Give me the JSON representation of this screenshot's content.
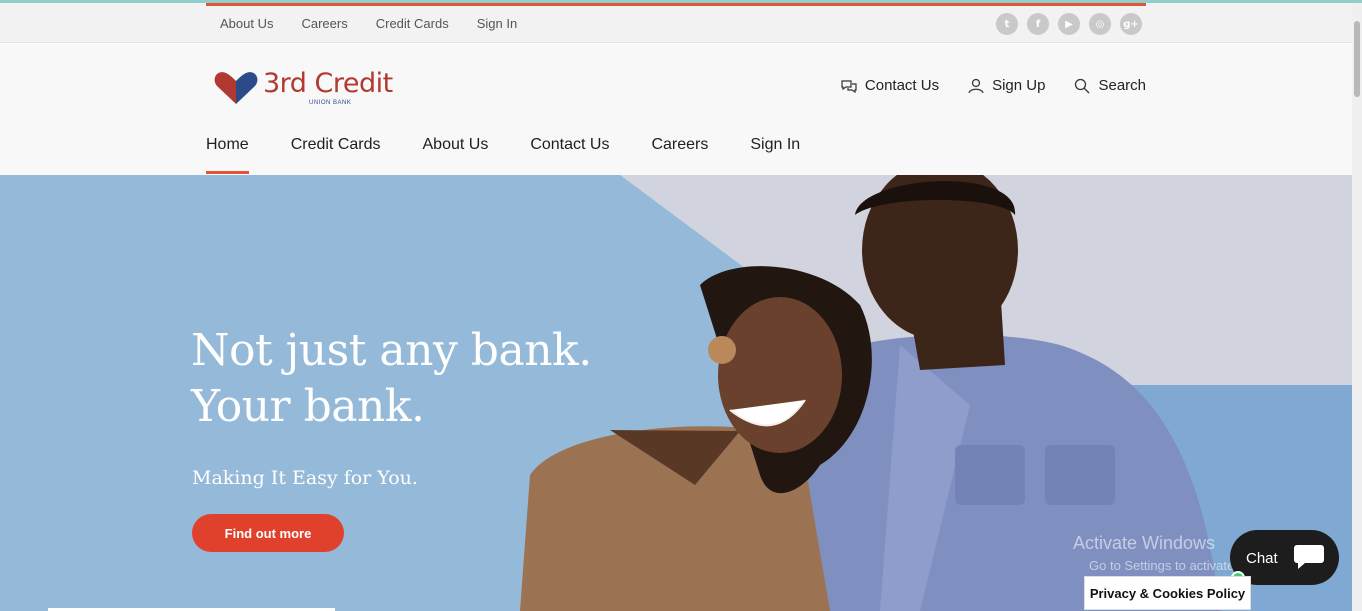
{
  "utility_bar": {
    "links": [
      "About Us",
      "Careers",
      "Credit Cards",
      "Sign In"
    ],
    "social_icons": [
      "twitter-icon",
      "facebook-icon",
      "youtube-icon",
      "instagram-icon",
      "google-plus-icon"
    ]
  },
  "brand": {
    "name": "3rd Credit",
    "subtitle": "UNION BANK",
    "color_red": "#b03a32",
    "color_blue": "#2a4a8a"
  },
  "header_actions": {
    "contact": "Contact Us",
    "signup": "Sign Up",
    "search": "Search"
  },
  "main_nav": {
    "items": [
      "Home",
      "Credit Cards",
      "About Us",
      "Contact Us",
      "Careers",
      "Sign In"
    ],
    "active": "Home"
  },
  "hero": {
    "title_line1": "Not just any bank.",
    "title_line2": "Your bank.",
    "subtitle": "Making It Easy for You.",
    "cta": "Find out more"
  },
  "overlay": {
    "watermark_title": "Activate Windows",
    "watermark_sub": "Go to Settings to activate Windows.",
    "chat_label": "Chat",
    "privacy_label": "Privacy & Cookies Policy"
  },
  "colors": {
    "accent": "#e2533a",
    "cta": "#e0412d",
    "hero_bg": "#95b9d9"
  }
}
